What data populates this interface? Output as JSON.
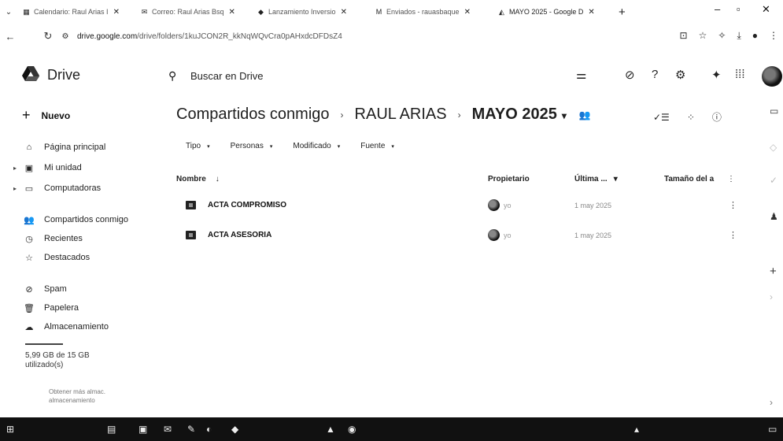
{
  "browser": {
    "tabs": [
      {
        "title": "Calendario: Raul Arias I",
        "icon": "calendar-icon",
        "glyph": "▦"
      },
      {
        "title": "Correo: Raul Arias Bsq",
        "icon": "mail-icon",
        "glyph": "✉"
      },
      {
        "title": "Lanzamiento Inversio",
        "icon": "sparkle-icon",
        "glyph": "◆"
      },
      {
        "title": "Enviados - rauasbaque",
        "icon": "gmail-icon",
        "glyph": "M"
      },
      {
        "title": "MAYO 2025 - Google D",
        "icon": "drive-icon",
        "glyph": "◭"
      }
    ],
    "url_prefix": "drive.google.com",
    "url_rest": "/drive/folders/1kuJCON2R_kkNqWQvCra0pAHxdcDFDsZ4"
  },
  "app": {
    "brand": "Drive",
    "search_placeholder": "Buscar en Drive"
  },
  "sidebar": {
    "new_label": "Nuevo",
    "items": [
      {
        "label": "Página principal",
        "icon": "home-icon",
        "glyph": "⌂"
      },
      {
        "label": "Mi unidad",
        "icon": "my-drive-icon",
        "glyph": "▣"
      },
      {
        "label": "Computadoras",
        "icon": "computer-icon",
        "glyph": "▭"
      },
      {
        "label": "Compartidos conmigo",
        "icon": "shared-icon",
        "glyph": "👥"
      },
      {
        "label": "Recientes",
        "icon": "clock-icon",
        "glyph": "◷"
      },
      {
        "label": "Destacados",
        "icon": "star-icon",
        "glyph": "☆"
      },
      {
        "label": "Spam",
        "icon": "spam-icon",
        "glyph": "⊘"
      },
      {
        "label": "Papelera",
        "icon": "trash-icon",
        "glyph": "🗑"
      },
      {
        "label": "Almacenamiento",
        "icon": "cloud-icon",
        "glyph": "☁"
      }
    ],
    "storage_used": "5,99 GB de 15 GB",
    "storage_sub": "utilizado(s)",
    "storage_note_1": "Obtener más almac.",
    "storage_note_2": "almacenamiento"
  },
  "main": {
    "crumb_1": "Compartidos conmigo",
    "crumb_2": "RAUL ARIAS",
    "crumb_3": "MAYO 2025",
    "filters": [
      "Tipo",
      "Personas",
      "Modificado",
      "Fuente"
    ],
    "columns": {
      "name": "Nombre",
      "owner": "Propietario",
      "modified": "Última ...",
      "size": "Tamaño del a"
    },
    "rows": [
      {
        "name": "ACTA COMPROMISO",
        "owner": "yo",
        "modified": "1 may 2025"
      },
      {
        "name": "ACTA ASESORIA",
        "owner": "yo",
        "modified": "1 may 2025"
      }
    ]
  },
  "colors": {
    "taskbar": "#111111",
    "text": "#1f1f1f"
  }
}
